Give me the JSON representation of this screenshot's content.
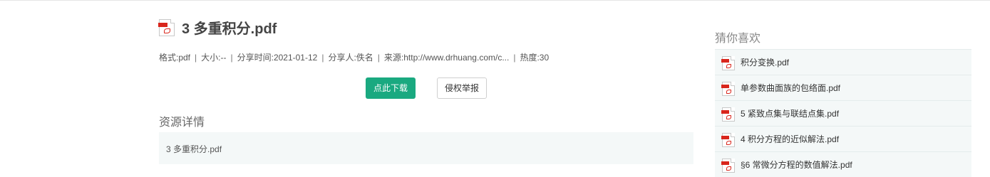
{
  "document": {
    "title": "3 多重积分.pdf",
    "meta": {
      "format": "格式:pdf",
      "size": "大小:--",
      "share_time": "分享时间:2021-01-12",
      "sharer": "分享人:佚名",
      "source": "来源:http://www.drhuang.com/c...",
      "popularity": "热度:30",
      "separator": "|"
    },
    "download_label": "点此下载",
    "report_label": "侵权举报",
    "details_heading": "资源详情",
    "details_text": "3 多重积分.pdf"
  },
  "sidebar": {
    "title": "猜你喜欢",
    "items": [
      {
        "label": "积分变换.pdf"
      },
      {
        "label": "单参数曲面族的包络面.pdf"
      },
      {
        "label": "5 紧致点集与联结点集.pdf"
      },
      {
        "label": "4 积分方程的近似解法.pdf"
      },
      {
        "label": "§6 常微分方程的数值解法.pdf"
      }
    ]
  },
  "icons": {
    "file": "pdf-file-icon"
  },
  "colors": {
    "accent": "#1aa980",
    "panel": "#f4f8f8",
    "pdf_red": "#d9261c"
  }
}
